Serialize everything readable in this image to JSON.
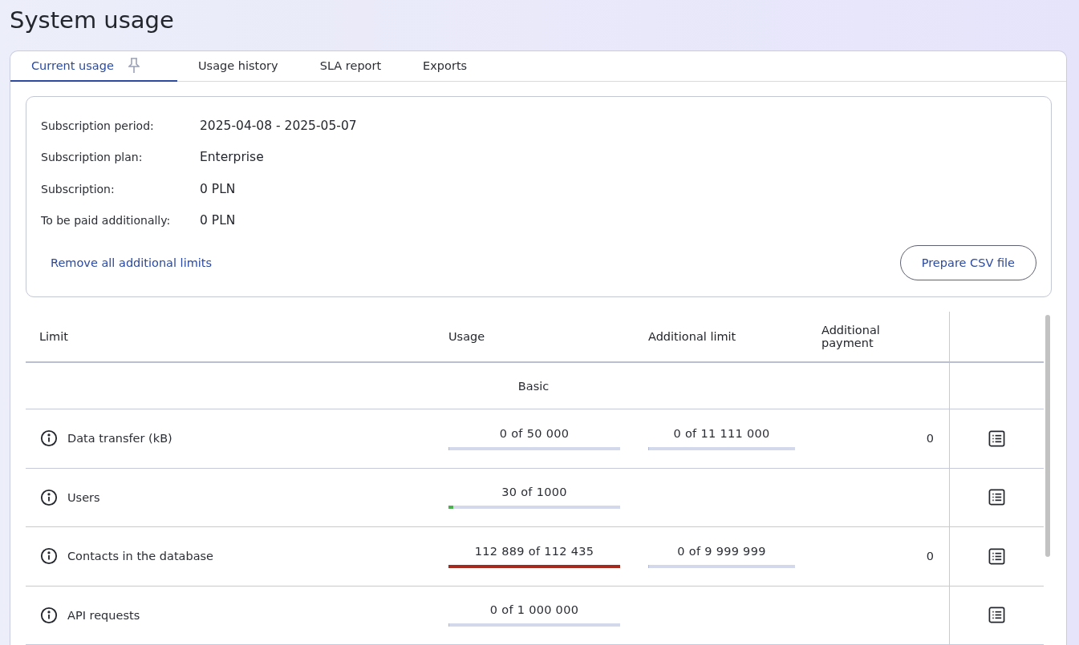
{
  "page_title": "System usage",
  "tabs": [
    {
      "label": "Current usage",
      "selected": true,
      "pinned": true
    },
    {
      "label": "Usage history",
      "selected": false,
      "pinned": false
    },
    {
      "label": "SLA report",
      "selected": false,
      "pinned": false
    },
    {
      "label": "Exports",
      "selected": false,
      "pinned": false
    }
  ],
  "summary": {
    "fields": [
      {
        "label": "Subscription period:",
        "value": "2025-04-08 - 2025-05-07"
      },
      {
        "label": "Subscription plan:",
        "value": "Enterprise"
      },
      {
        "label": "Subscription:",
        "value": "0 PLN"
      },
      {
        "label": "To be paid additionally:",
        "value": "0 PLN"
      }
    ],
    "link": "Remove all additional limits",
    "button": "Prepare CSV file"
  },
  "table": {
    "columns": [
      "Limit",
      "Usage",
      "Additional limit",
      "Additional payment"
    ],
    "group": "Basic",
    "rows": [
      {
        "name": "Data transfer (kB)",
        "usage": {
          "text": "0 of 50 000",
          "level": 0
        },
        "additional_limit": {
          "text": "0 of 11 111 000",
          "level": 0
        },
        "payment": "0"
      },
      {
        "name": "Users",
        "usage": {
          "text": "30 of 1000",
          "level": 0.03,
          "color": "#4caf50"
        }
      },
      {
        "name": "Contacts in the database",
        "usage": {
          "text": "112 889 of 112 435",
          "level": 1,
          "color": "#a52a1e"
        },
        "additional_limit": {
          "text": "0 of 9 999 999",
          "level": 0
        },
        "payment": "0"
      },
      {
        "name": "API requests",
        "usage": {
          "text": "0 of 1 000 000",
          "level": 0
        }
      }
    ]
  }
}
